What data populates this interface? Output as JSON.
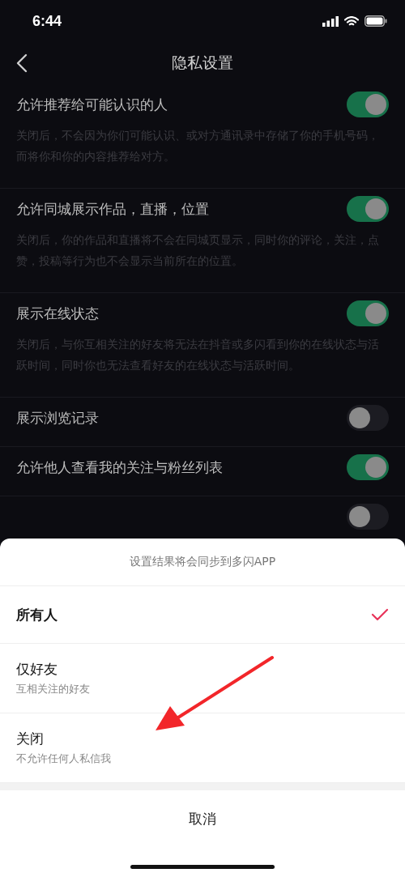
{
  "status_bar": {
    "time": "6:44"
  },
  "nav": {
    "title": "隐私设置"
  },
  "settings": [
    {
      "title": "允许推荐给可能认识的人",
      "description": "关闭后，不会因为你们可能认识、或对方通讯录中存储了你的手机号码，而将你和你的内容推荐给对方。",
      "on": true
    },
    {
      "title": "允许同城展示作品，直播，位置",
      "description": "关闭后，你的作品和直播将不会在同城页显示，同时你的评论，关注，点赞，投稿等行为也不会显示当前所在的位置。",
      "on": true
    },
    {
      "title": "展示在线状态",
      "description": "关闭后，与你互相关注的好友将无法在抖音或多闪看到你的在线状态与活跃时间，同时你也无法查看好友的在线状态与活跃时间。",
      "on": true
    },
    {
      "title": "展示浏览记录",
      "on": false
    },
    {
      "title": "允许他人查看我的关注与粉丝列表",
      "on": true
    },
    {
      "on": false
    }
  ],
  "sheet": {
    "note": "设置结果将会同步到多闪APP",
    "options": [
      {
        "label": "所有人",
        "selected": true
      },
      {
        "label": "仅好友",
        "sublabel": "互相关注的好友",
        "selected": false
      },
      {
        "label": "关闭",
        "sublabel": "不允许任何人私信我",
        "selected": false
      }
    ],
    "cancel": "取消"
  }
}
